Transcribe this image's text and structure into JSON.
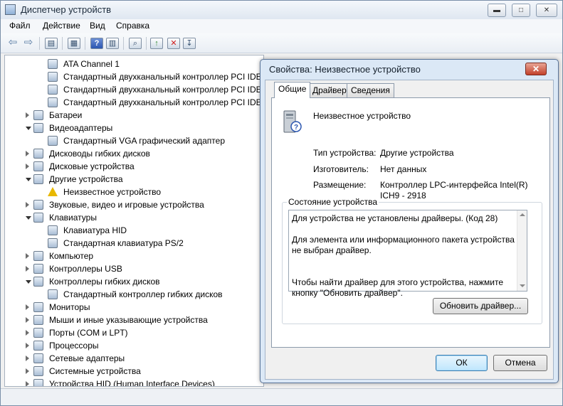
{
  "window": {
    "title": "Диспетчер устройств",
    "controls": {
      "minimize": "▬",
      "maximize": "□",
      "close": "✕"
    }
  },
  "menu": [
    "Файл",
    "Действие",
    "Вид",
    "Справка"
  ],
  "toolbar": {
    "back_icon": "back-arrow-icon",
    "forward_icon": "forward-arrow-icon",
    "glyphs": {
      "back": "⇦",
      "forward": "⇨",
      "view": "▤",
      "props": "▦",
      "help": "?",
      "panel": "▥",
      "scan": "⌕",
      "update": "↑",
      "disable": "✕",
      "uninstall": "↧"
    }
  },
  "tree": [
    {
      "label": "ATA Channel 1",
      "level": 2
    },
    {
      "label": "Стандартный двухканальный контроллер PCI IDE",
      "level": 2
    },
    {
      "label": "Стандартный двухканальный контроллер PCI IDE",
      "level": 2
    },
    {
      "label": "Стандартный двухканальный контроллер PCI IDE",
      "level": 2
    },
    {
      "label": "Батареи",
      "level": 1,
      "expanded": false
    },
    {
      "label": "Видеоадаптеры",
      "level": 1,
      "expanded": true
    },
    {
      "label": "Стандартный VGA графический адаптер",
      "level": 2
    },
    {
      "label": "Дисководы гибких дисков",
      "level": 1,
      "expanded": false
    },
    {
      "label": "Дисковые устройства",
      "level": 1,
      "expanded": false
    },
    {
      "label": "Другие устройства",
      "level": 1,
      "expanded": true
    },
    {
      "label": "Неизвестное устройство",
      "level": 2,
      "warning": true
    },
    {
      "label": "Звуковые, видео и игровые устройства",
      "level": 1,
      "expanded": false
    },
    {
      "label": "Клавиатуры",
      "level": 1,
      "expanded": true
    },
    {
      "label": "Клавиатура HID",
      "level": 2
    },
    {
      "label": "Стандартная клавиатура PS/2",
      "level": 2
    },
    {
      "label": "Компьютер",
      "level": 1,
      "expanded": false
    },
    {
      "label": "Контроллеры USB",
      "level": 1,
      "expanded": false
    },
    {
      "label": "Контроллеры гибких дисков",
      "level": 1,
      "expanded": true
    },
    {
      "label": "Стандартный контроллер гибких дисков",
      "level": 2
    },
    {
      "label": "Мониторы",
      "level": 1,
      "expanded": false
    },
    {
      "label": "Мыши и иные указывающие устройства",
      "level": 1,
      "expanded": false
    },
    {
      "label": "Порты (COM и LPT)",
      "level": 1,
      "expanded": false
    },
    {
      "label": "Процессоры",
      "level": 1,
      "expanded": false
    },
    {
      "label": "Сетевые адаптеры",
      "level": 1,
      "expanded": false
    },
    {
      "label": "Системные устройства",
      "level": 1,
      "expanded": false
    },
    {
      "label": "Устройства HID (Human Interface Devices)",
      "level": 1,
      "expanded": false
    }
  ],
  "dialog": {
    "title": "Свойства: Неизвестное устройство",
    "close": "✕",
    "tabs": [
      "Общие",
      "Драйвер",
      "Сведения"
    ],
    "device_name": "Неизвестное устройство",
    "props": [
      {
        "label": "Тип устройства:",
        "value": "Другие устройства"
      },
      {
        "label": "Изготовитель:",
        "value": "Нет данных"
      },
      {
        "label": "Размещение:",
        "value": "Контроллер LPC-интерфейса Intel(R) ICH9 - 2918"
      }
    ],
    "status_title": "Состояние устройства",
    "status_text": "Для устройства не установлены драйверы. (Код 28)\n\nДля элемента или информационного пакета устройства не выбран драйвер.\n\n\nЧтобы найти драйвер для этого устройства, нажмите кнопку \"Обновить драйвер\".",
    "update_button": "Обновить драйвер...",
    "ok_button": "ОК",
    "cancel_button": "Отмена"
  }
}
